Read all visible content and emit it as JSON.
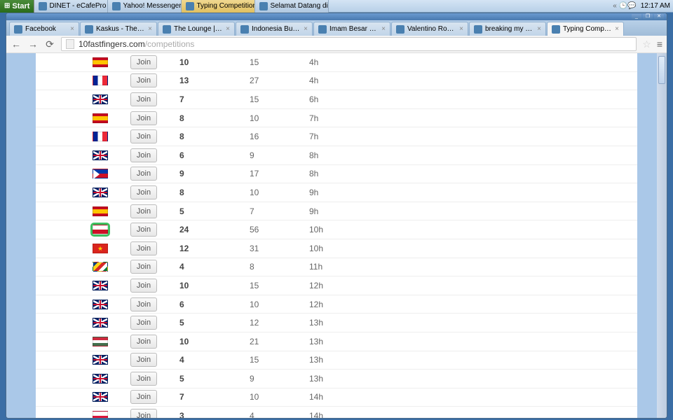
{
  "taskbar": {
    "start": "Start",
    "items": [
      {
        "label": "DINET - eCafePro Server..."
      },
      {
        "label": "Yahoo! Messenger"
      },
      {
        "label": "Typing Competition - ...",
        "active": true
      },
      {
        "label": "Selamat Datang di Faceb..."
      }
    ],
    "clock": "12:17 AM",
    "tray_sep": "«"
  },
  "window": {
    "controls": {
      "min": "_",
      "max": "❐",
      "close": "✕"
    }
  },
  "tabs": [
    {
      "title": "Facebook"
    },
    {
      "title": "Kaskus - The Larges"
    },
    {
      "title": "The Lounge | Kaskus"
    },
    {
      "title": "Indonesia Bukan Neg"
    },
    {
      "title": "Imam Besar FPI Rizie"
    },
    {
      "title": "Valentino Rossi MEN"
    },
    {
      "title": "breaking my heart - "
    },
    {
      "title": "Typing Competition -",
      "active": true
    }
  ],
  "address": {
    "host": "10fastfingers.com",
    "path": "/competitions"
  },
  "join_label": "Join",
  "rows": [
    {
      "flag": "es",
      "c1": "10",
      "c2": "15",
      "c3": "4h"
    },
    {
      "flag": "fr",
      "c1": "13",
      "c2": "27",
      "c3": "4h"
    },
    {
      "flag": "gb",
      "c1": "7",
      "c2": "15",
      "c3": "6h"
    },
    {
      "flag": "es",
      "c1": "8",
      "c2": "10",
      "c3": "7h"
    },
    {
      "flag": "fr",
      "c1": "8",
      "c2": "16",
      "c3": "7h"
    },
    {
      "flag": "gb",
      "c1": "6",
      "c2": "9",
      "c3": "8h"
    },
    {
      "flag": "ph",
      "c1": "9",
      "c2": "17",
      "c3": "8h"
    },
    {
      "flag": "gb",
      "c1": "8",
      "c2": "10",
      "c3": "9h"
    },
    {
      "flag": "es",
      "c1": "5",
      "c2": "7",
      "c3": "9h"
    },
    {
      "flag": "id",
      "c1": "24",
      "c2": "56",
      "c3": "10h",
      "highlight": true
    },
    {
      "flag": "vn",
      "c1": "12",
      "c2": "31",
      "c3": "10h"
    },
    {
      "flag": "sc",
      "c1": "4",
      "c2": "8",
      "c3": "11h"
    },
    {
      "flag": "gb",
      "c1": "10",
      "c2": "15",
      "c3": "12h"
    },
    {
      "flag": "gb",
      "c1": "6",
      "c2": "10",
      "c3": "12h"
    },
    {
      "flag": "gb",
      "c1": "5",
      "c2": "12",
      "c3": "13h"
    },
    {
      "flag": "hu",
      "c1": "10",
      "c2": "21",
      "c3": "13h"
    },
    {
      "flag": "gb",
      "c1": "4",
      "c2": "15",
      "c3": "13h"
    },
    {
      "flag": "gb",
      "c1": "5",
      "c2": "9",
      "c3": "13h"
    },
    {
      "flag": "gb",
      "c1": "7",
      "c2": "10",
      "c3": "14h"
    },
    {
      "flag": "pl",
      "c1": "3",
      "c2": "4",
      "c3": "14h"
    }
  ]
}
